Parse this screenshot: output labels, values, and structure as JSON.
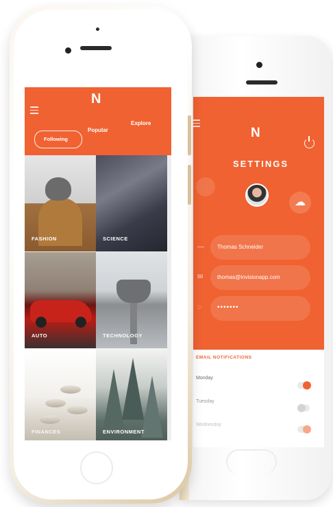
{
  "front_phone": {
    "logo": "N",
    "tabs": [
      {
        "label": "Following",
        "active": true
      },
      {
        "label": "Popular",
        "active": false
      },
      {
        "label": "Explore",
        "active": false
      }
    ],
    "categories": [
      {
        "label": "FASHION"
      },
      {
        "label": "SCIENCE"
      },
      {
        "label": "AUTO"
      },
      {
        "label": "TECHNOLOGY"
      },
      {
        "label": "FINANCES"
      },
      {
        "label": "ENVIRONMENT"
      }
    ]
  },
  "settings_phone": {
    "logo": "N",
    "title": "SETTINGS",
    "name_value": "Thomas Schneider",
    "email_value": "thomas@invisionapp.com",
    "password_value": "•••••••",
    "notifications_heading": "EMAIL NOTIFICATIONS",
    "days": [
      {
        "label": "Monday",
        "on": true
      },
      {
        "label": "Tuesday",
        "on": false
      },
      {
        "label": "Wednesday",
        "on": true
      }
    ]
  },
  "colors": {
    "accent": "#f06232",
    "phone_gold": "#dcc7a2"
  }
}
